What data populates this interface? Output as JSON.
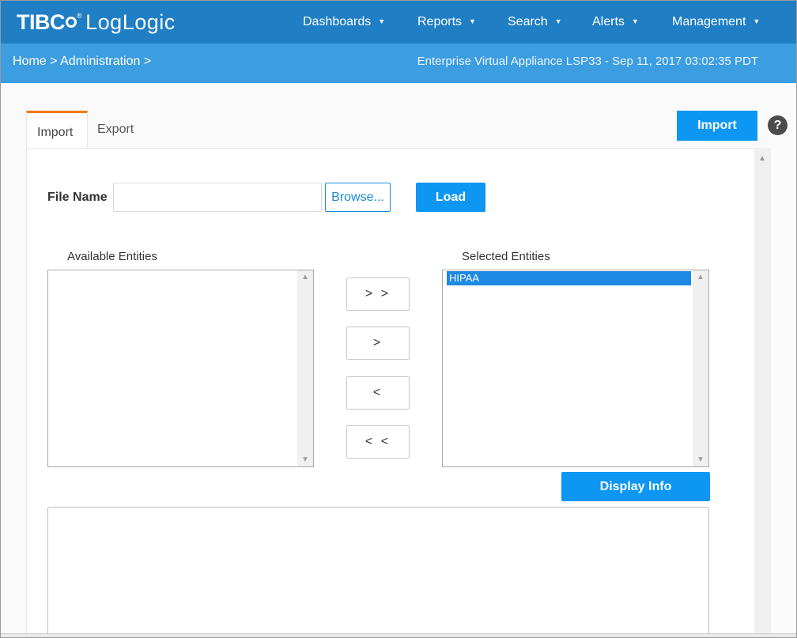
{
  "brand": {
    "name_part1": "TIBC",
    "reg": "®",
    "name_part2": "LogLogic"
  },
  "nav": {
    "dashboards": "Dashboards",
    "reports": "Reports",
    "search": "Search",
    "alerts": "Alerts",
    "management": "Management",
    "caret": "▼"
  },
  "breadcrumb": "Home > Administration >",
  "appliance_info": "Enterprise Virtual Appliance LSP33 - Sep 11, 2017 03:02:35 PDT",
  "tabs": {
    "import": "Import",
    "export": "Export"
  },
  "actions": {
    "import_button": "Import",
    "help": "?"
  },
  "file": {
    "label": "File Name",
    "value": "",
    "browse_button": "Browse...",
    "load_button": "Load"
  },
  "entities": {
    "available_label": "Available Entities",
    "selected_label": "Selected Entities",
    "available_items": [],
    "selected_items": [
      "HIPAA"
    ]
  },
  "movers": {
    "add_all": "> >",
    "add_one": ">",
    "remove_one": "<",
    "remove_all": "< <"
  },
  "display_info_button": "Display Info",
  "info_text": ""
}
